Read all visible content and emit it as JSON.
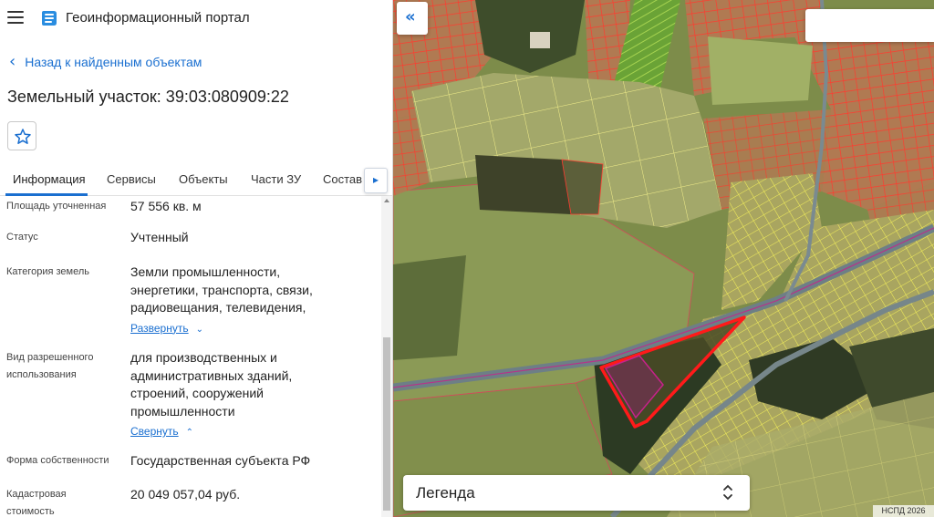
{
  "app": {
    "title": "Геоинформационный портал"
  },
  "navigation": {
    "back_label": "Назад к найденным объектам"
  },
  "object": {
    "title": "Земельный участок: 39:03:080909:22"
  },
  "tabs": [
    {
      "label": "Информация",
      "active": true
    },
    {
      "label": "Сервисы",
      "active": false
    },
    {
      "label": "Объекты",
      "active": false
    },
    {
      "label": "Части ЗУ",
      "active": false
    },
    {
      "label": "Состав",
      "active": false
    }
  ],
  "details": {
    "area_label": "Площадь уточненная",
    "area_value": "57 556 кв. м",
    "status_label": "Статус",
    "status_value": "Учтенный",
    "category_label": "Категория земель",
    "category_lines": [
      "Земли промышленности,",
      "энергетики, транспорта, связи,",
      "радиовещания, телевидения,"
    ],
    "expand_link": "Развернуть",
    "use_label_lines": [
      "Вид разрешенного",
      "использования"
    ],
    "use_lines": [
      "для производственных и",
      "административных зданий,",
      "строений, сооружений",
      "промышленности"
    ],
    "collapse_link": "Свернуть",
    "ownership_label": "Форма собственности",
    "ownership_value": "Государственная субъекта РФ",
    "cost_label_lines": [
      "Кадастровая",
      "стоимость"
    ],
    "cost_value": "20 049 057,04 руб."
  },
  "map": {
    "legend_label": "Легенда",
    "attribution": "НСПД 2026",
    "search_placeholder": "",
    "colors": {
      "selection": "#ff1a1a",
      "parcel_border": "#ff3b2f",
      "parcel_fill": "#c9a06e",
      "survey": "#f3ef5a",
      "road": "#6d7f86",
      "highlight": "#c7228a"
    }
  },
  "colors": {
    "accent": "#1a6fd0"
  }
}
